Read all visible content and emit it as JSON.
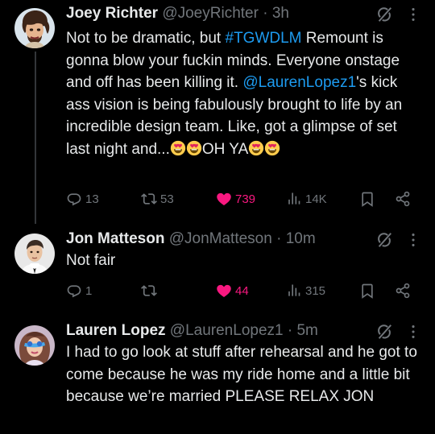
{
  "tweets": [
    {
      "name": "Joey Richter",
      "handle": "@JoeyRichter",
      "time": "3h",
      "body": {
        "t1": "Not to be dramatic, but ",
        "hashtag": "#TGWDLM",
        "t2": " Remount is gonna blow your fuckin minds. Everyone onstage and off has been killing it. ",
        "mention": "@LaurenLopez1",
        "t3": "'s kick ass vision is being fabulously brought to life by an incredible design team. Like, got a glimpse of set last night and...",
        "t4": "OH YA"
      },
      "replies": "13",
      "reposts": "53",
      "likes": "739",
      "views": "14K"
    },
    {
      "name": "Jon Matteson",
      "handle": "@JonMatteson",
      "time": "10m",
      "body": "Not fair",
      "replies": "1",
      "reposts": "",
      "likes": "44",
      "views": "315"
    },
    {
      "name": "Lauren Lopez",
      "handle": "@LaurenLopez1",
      "time": "5m",
      "body": "I had to go look at stuff after rehearsal and he got to come because he was my ride home and a little bit because we’re married PLEASE RELAX JON"
    }
  ],
  "dot": "·",
  "colors": {
    "background": "#000000",
    "text": "#e7e9ea",
    "muted": "#71767b",
    "link": "#1d9bf0",
    "like": "#f91880"
  },
  "icons": [
    "reply-icon",
    "repost-icon",
    "like-icon",
    "views-icon",
    "bookmark-icon",
    "share-icon",
    "grok-icon",
    "more-icon",
    "heart-eyes-emoji"
  ]
}
